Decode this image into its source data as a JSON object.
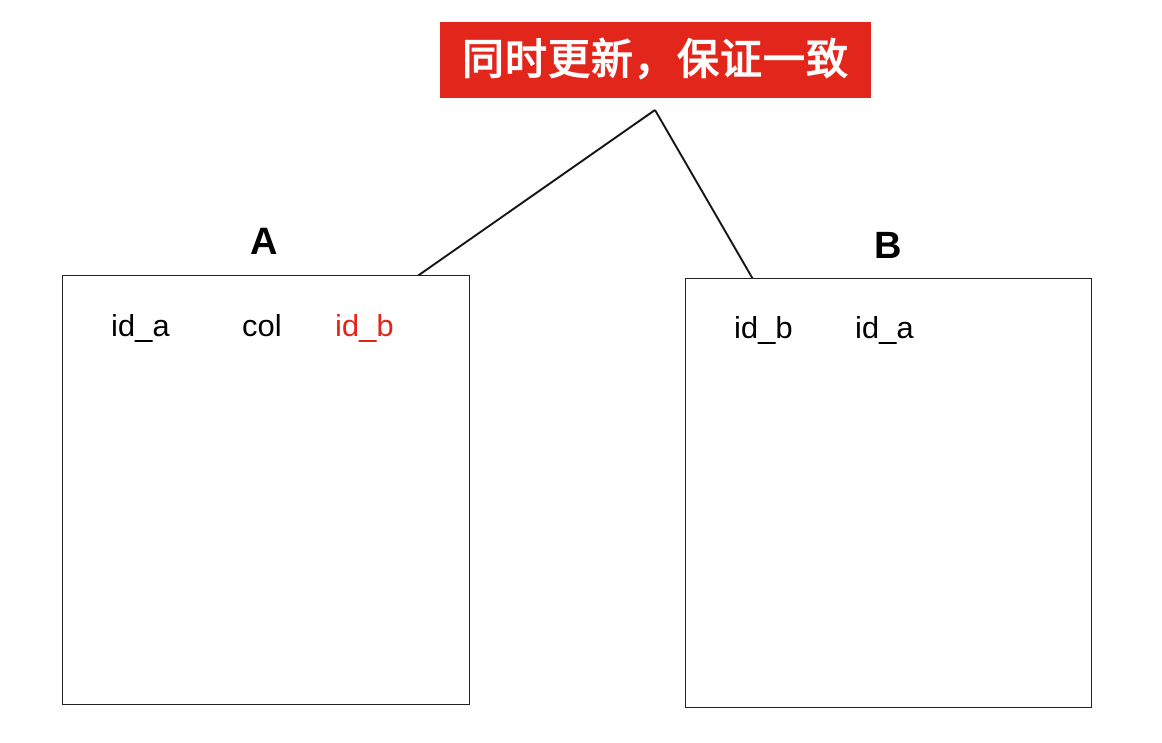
{
  "callout": {
    "text": "同时更新，保证一致",
    "background_color": "#e3261b",
    "text_color": "#ffffff"
  },
  "tables": [
    {
      "name": "A",
      "columns": [
        {
          "label": "id_a",
          "highlighted": false
        },
        {
          "label": "col",
          "highlighted": false
        },
        {
          "label": "id_b",
          "highlighted": true
        }
      ]
    },
    {
      "name": "B",
      "columns": [
        {
          "label": "id_b",
          "highlighted": false
        },
        {
          "label": "id_a",
          "highlighted": false
        }
      ]
    }
  ],
  "connections": [
    {
      "from": "callout",
      "to": "A.id_b"
    },
    {
      "from": "callout",
      "to": "B.id_b"
    }
  ],
  "colors": {
    "highlight": "#e3261b",
    "line": "#111111",
    "border": "#222222"
  }
}
